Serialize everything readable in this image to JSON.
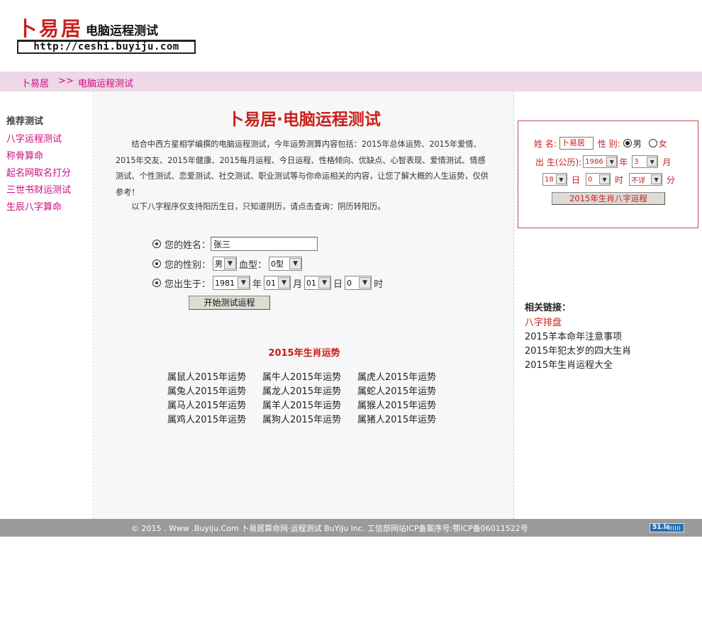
{
  "header": {
    "logo_brand": "卜易居",
    "logo_subtitle": "电脑运程测试",
    "logo_url": "http://ceshi.buyiju.com"
  },
  "breadcrumb": {
    "home": "卜易居",
    "separator": ">>",
    "current": "电脑运程测试"
  },
  "sidebar": {
    "title": "推荐测试",
    "items": [
      {
        "label": "八字运程测试"
      },
      {
        "label": "称骨算命"
      },
      {
        "label": "起名网取名打分"
      },
      {
        "label": "三世书财运测试"
      },
      {
        "label": "生辰八字算命"
      }
    ]
  },
  "main": {
    "title": "卜易居·电脑运程测试",
    "intro": "结合中西方星相学编撰的电脑运程测试，今年运势测算内容包括：2015年总体运势、2015年爱情、2015年交友、2015年健康、2015每月运程、今日运程、性格倾向、优缺点、心智表现、爱情测试、情感测试、个性测试、恋爱测试、社交测试、职业测试等与你命运相关的内容，让您了解大概的人生运势，仅供参考！",
    "intro2": "以下八字程序仅支持阳历生日，只知道阴历，请点击查询：阴历转阳历。",
    "form": {
      "name_label": "您的姓名：",
      "name_value": "张三",
      "gender_label": "您的性别：",
      "gender_value": "男",
      "blood_label": "血型：",
      "blood_value": "0型",
      "birth_label": "您出生于：",
      "year_value": "1981",
      "year_unit": "年",
      "month_value": "01",
      "month_unit": "月",
      "day_value": "01",
      "day_unit": "日",
      "hour_value": "0",
      "hour_unit": "时",
      "submit": "开始测试运程"
    },
    "zodiac_title": "2015年生肖运势",
    "zodiac_links": [
      "属鼠人2015年运势",
      "属牛人2015年运势",
      "属虎人2015年运势",
      "属兔人2015年运势",
      "属龙人2015年运势",
      "属蛇人2015年运势",
      "属马人2015年运势",
      "属羊人2015年运势",
      "属猴人2015年运势",
      "属鸡人2015年运势",
      "属狗人2015年运势",
      "属猪人2015年运势"
    ]
  },
  "right_form": {
    "name_label": "姓 名:",
    "name_value": "卜易居",
    "gender_label": "性 别:",
    "male": "男",
    "female": "女",
    "birth_label": "出 生(公历):",
    "year_value": "1986",
    "year_unit": "年",
    "month_value": "3",
    "month_unit": "月",
    "day_value": "18",
    "day_unit": "日",
    "hour_value": "0",
    "hour_unit": "时",
    "minute_value": "不详",
    "minute_unit": "分",
    "submit": "2015年生肖八字运程"
  },
  "related": {
    "title": "相关链接：",
    "links": [
      {
        "label": "八字排盘"
      },
      {
        "label": "2015羊本命年注意事项"
      },
      {
        "label": "2015年犯太岁的四大生肖"
      },
      {
        "label": "2015年生肖运程大全"
      }
    ]
  },
  "footer": {
    "text": "© 2015 . Www .Buyiju.Com 卜易居算命网·运程测试 BuYiJu Inc. 工信部网站ICP备案序号:鄂ICP备06011522号",
    "badge": "51.la"
  },
  "colors": {
    "accent_red": "#c8201d",
    "link_pink": "#cc0b7f",
    "crumb_bg": "#ecd8e6",
    "footer_bg": "#9a9a9a"
  }
}
